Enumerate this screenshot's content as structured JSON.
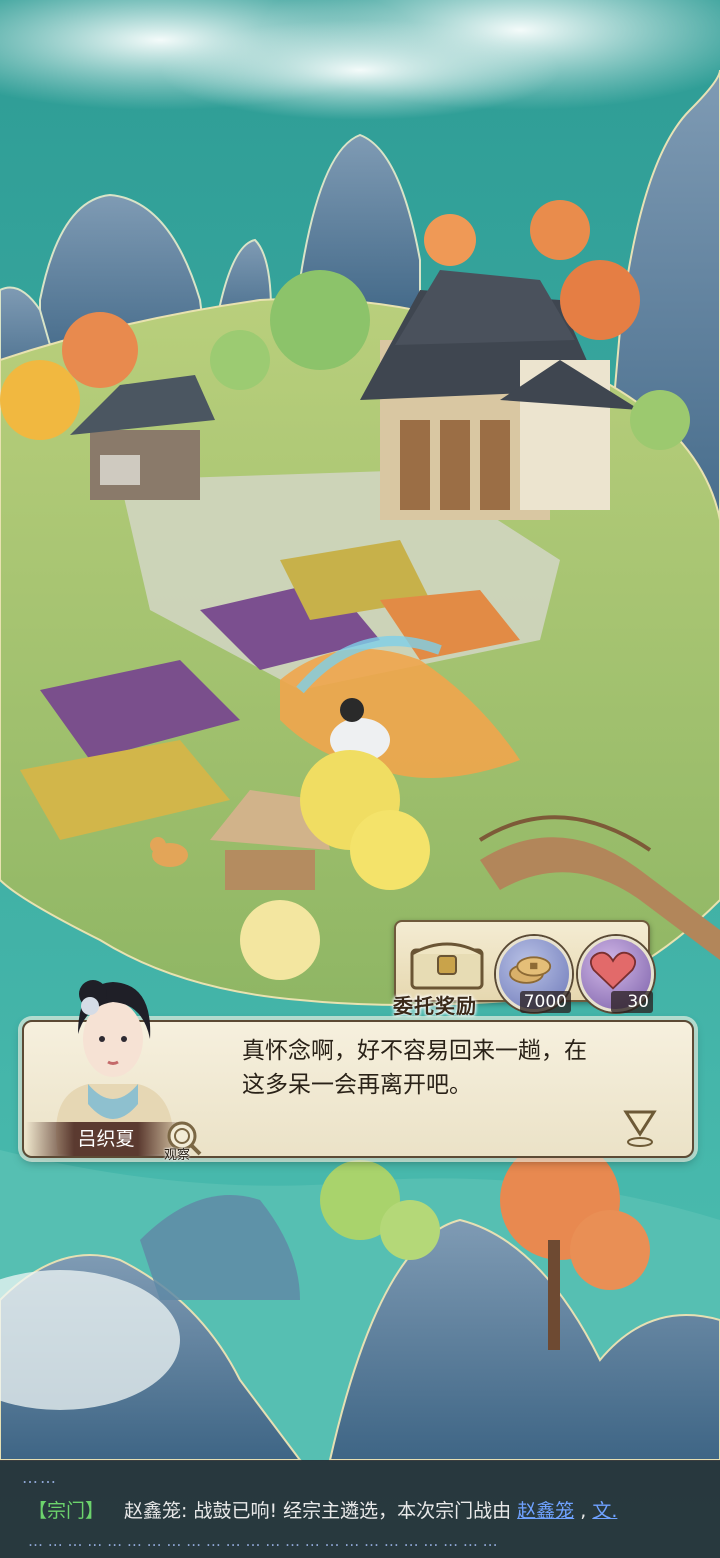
{
  "reward": {
    "title": "委托奖励",
    "items": [
      {
        "icon": "coins-icon",
        "count": "7000"
      },
      {
        "icon": "heart-icon",
        "count": "30"
      }
    ]
  },
  "dialogue": {
    "speaker": "吕织夏",
    "line1": "真怀念啊，好不容易回来一趟，在",
    "line2": "这多呆一会再离开吧。",
    "observe_label": "观察"
  },
  "chat": {
    "top_dots": "……",
    "channel": "【宗门】",
    "sender": "赵鑫笼",
    "message": ": 战鼓已响! 经宗主遴选，本次宗门战由 ",
    "link1": "赵鑫笼",
    "separator": " , ",
    "link2": "文.",
    "bottom_dots": "… … … … … … … … … … … … … … … … … … … … … … … …"
  },
  "colors": {
    "sea": "#3fb4a8",
    "dialog_bg": "#f2ead2",
    "chat_channel": "#6cd36c",
    "chat_link": "#6fa2ff"
  }
}
